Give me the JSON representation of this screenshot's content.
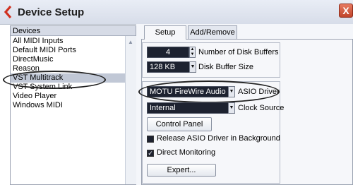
{
  "window": {
    "title": "Device Setup",
    "close_glyph": "X",
    "colors": {
      "titlebar": "#dde2ec",
      "accent": "#c0442a"
    }
  },
  "devices": {
    "header": "Devices",
    "items": [
      "All MIDI Inputs",
      "Default MIDI Ports",
      "DirectMusic",
      "Reason",
      "VST Multitrack",
      "VST System Link",
      "Video Player",
      "Windows MIDI"
    ],
    "selected": "VST Multitrack"
  },
  "tabs": [
    {
      "label": "Setup",
      "active": true
    },
    {
      "label": "Add/Remove",
      "active": false
    }
  ],
  "setup": {
    "disk_buffers_value": "4",
    "disk_buffers_label": "Number of Disk Buffers",
    "buffer_size_value": "128 KB",
    "buffer_size_label": "Disk Buffer Size",
    "asio_driver_value": "MOTU FireWire Audio",
    "asio_driver_label": "ASIO Driver",
    "clock_source_value": "Internal",
    "clock_source_label": "Clock Source",
    "control_panel_label": "Control Panel",
    "release_asio_label": "Release ASIO Driver in Background",
    "release_asio_checked": false,
    "direct_monitoring_label": "Direct Monitoring",
    "direct_monitoring_checked": true,
    "expert_label": "Expert..."
  }
}
